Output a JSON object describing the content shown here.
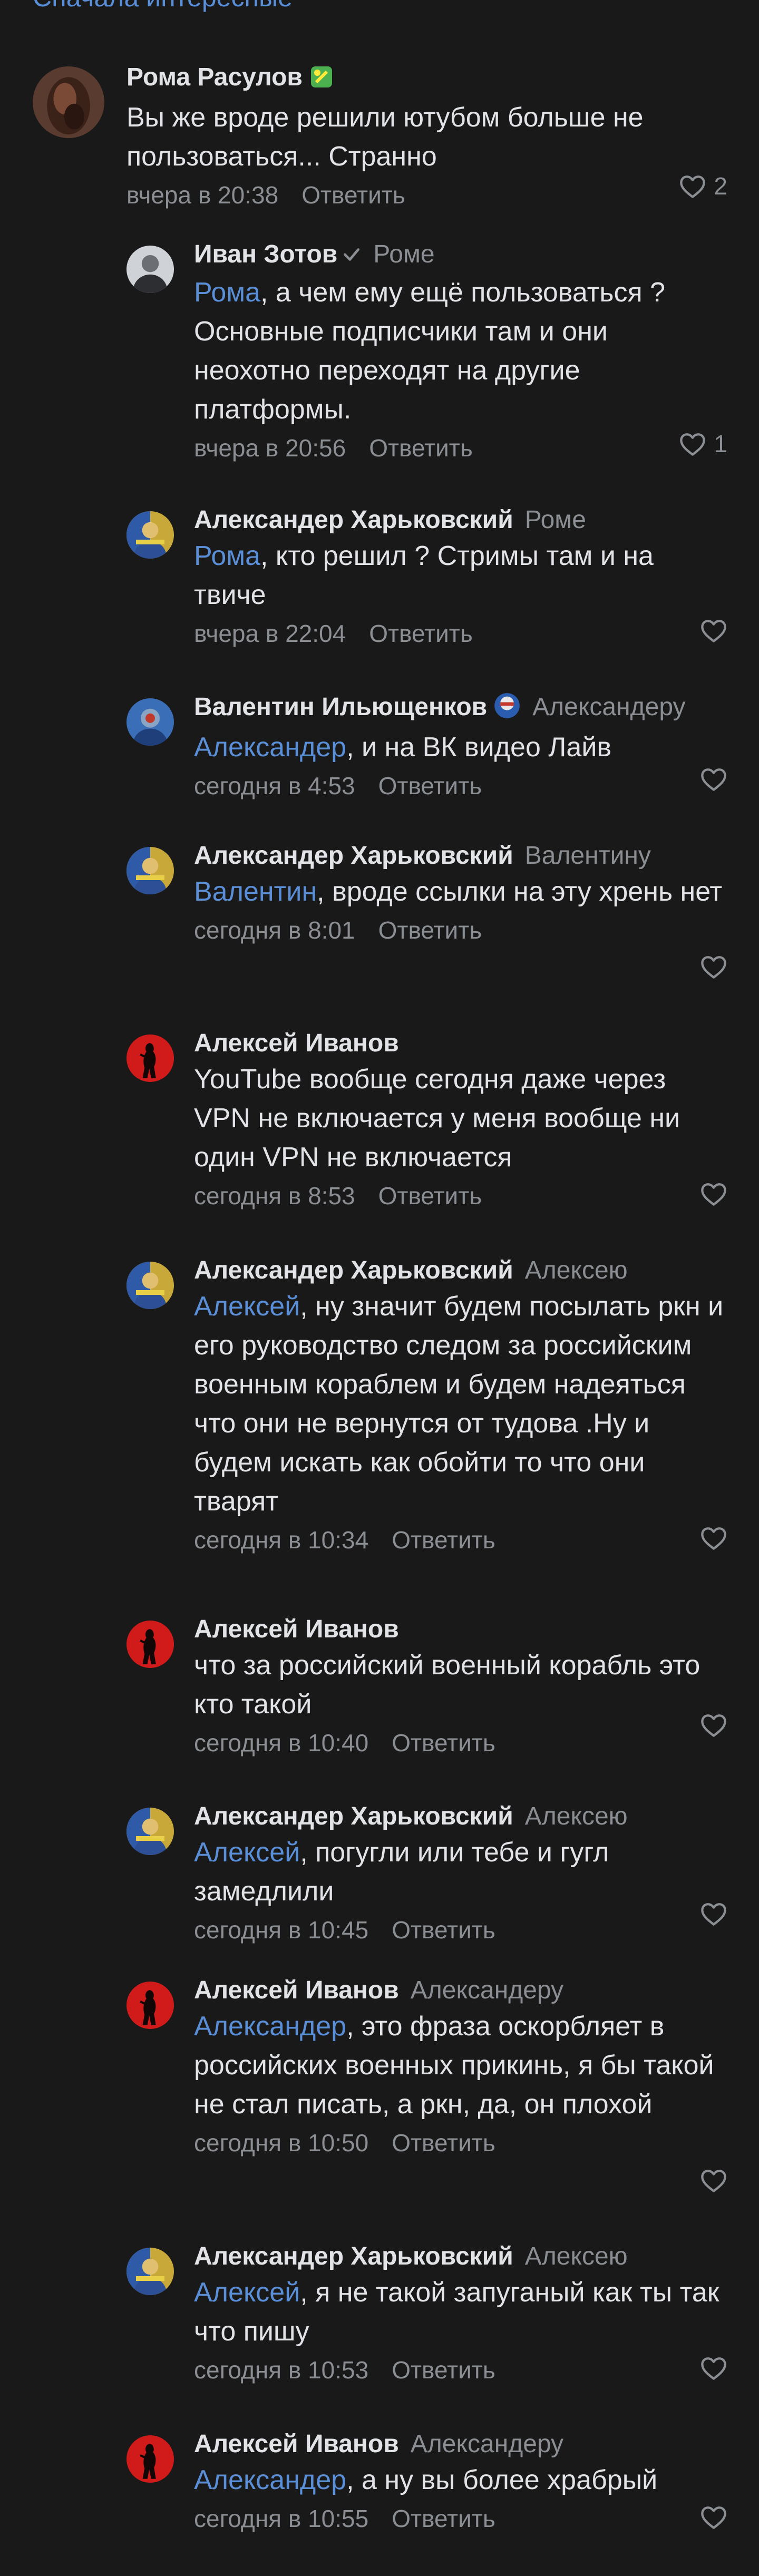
{
  "sort": {
    "label": "Сначала интересные"
  },
  "actions": {
    "reply": "Ответить"
  },
  "comments": [
    {
      "author": "Рома Расулов",
      "reply_to": "",
      "mention": "",
      "text": "Вы же вроде решили ютубом больше не пользоваться... Странно",
      "time": "вчера в 20:38",
      "likes": "2",
      "avatar": "photo-dark"
    },
    {
      "author": "Иван Зотов",
      "reply_to": "Роме",
      "mention": "Рома",
      "text": ", а чем ему ещё пользоваться ? Основные подписчики там и они неохотно переходят на другие платформы.",
      "time": "вчера в 20:56",
      "likes": "1",
      "avatar": "photo-grey"
    },
    {
      "author": "Александер Харьковский",
      "reply_to": "Роме",
      "mention": "Рома",
      "text": ", кто решил ? Стримы там и на твиче",
      "time": "вчера в 22:04",
      "likes": "",
      "avatar": "photo-yellow"
    },
    {
      "author": "Валентин Ильющенков",
      "reply_to": "Александеру",
      "mention": "Александер",
      "text": ", и на ВК видео Лайв",
      "time": "сегодня в 4:53",
      "likes": "",
      "avatar": "photo-blue"
    },
    {
      "author": "Александер Харьковский",
      "reply_to": "Валентину",
      "mention": "Валентин",
      "text": ", вроде ссылки на эту хрень нет",
      "time": "сегодня в 8:01",
      "likes": "",
      "avatar": "photo-yellow"
    },
    {
      "author": "Алексей Иванов",
      "reply_to": "",
      "mention": "",
      "text": "YouTube вообще сегодня даже через VPN не включается у меня вообще ни один VPN не включается",
      "time": "сегодня в 8:53",
      "likes": "",
      "avatar": "photo-red"
    },
    {
      "author": "Александер Харьковский",
      "reply_to": "Алексею",
      "mention": "Алексей",
      "text": ", ну значит будем посылать ркн и его руководство следом за российским военным кораблем и будем надеяться что они не вернутся от тудова .Ну и будем искать как обойти то что они тварят",
      "time": "сегодня в 10:34",
      "likes": "",
      "avatar": "photo-yellow"
    },
    {
      "author": "Алексей Иванов",
      "reply_to": "",
      "mention": "",
      "text": "что за российский военный корабль это кто такой",
      "time": "сегодня в 10:40",
      "likes": "",
      "avatar": "photo-red"
    },
    {
      "author": "Александер Харьковский",
      "reply_to": "Алексею",
      "mention": "Алексей",
      "text": ", погугли или тебе и гугл замедлили",
      "time": "сегодня в 10:45",
      "likes": "",
      "avatar": "photo-yellow"
    },
    {
      "author": "Алексей Иванов",
      "reply_to": "Александеру",
      "mention": "Александер",
      "text": ", это фраза оскорбляет в российских военных прикинь, я бы такой не стал писать, а ркн, да, он плохой",
      "time": "сегодня в 10:50",
      "likes": "",
      "avatar": "photo-red"
    },
    {
      "author": "Александер Харьковский",
      "reply_to": "Алексею",
      "mention": "Алексей",
      "text": ", я не такой запуганый как ты так что пишу",
      "time": "сегодня в 10:53",
      "likes": "",
      "avatar": "photo-yellow"
    },
    {
      "author": "Алексей Иванов",
      "reply_to": "Александеру",
      "mention": "Александер",
      "text": ", а ну вы более храбрый",
      "time": "сегодня в 10:55",
      "likes": "",
      "avatar": "photo-red"
    }
  ],
  "colors": {
    "background": "#19191a",
    "text": "#e1e3e6",
    "secondary": "#8b8e92",
    "link": "#5a8ed6"
  }
}
